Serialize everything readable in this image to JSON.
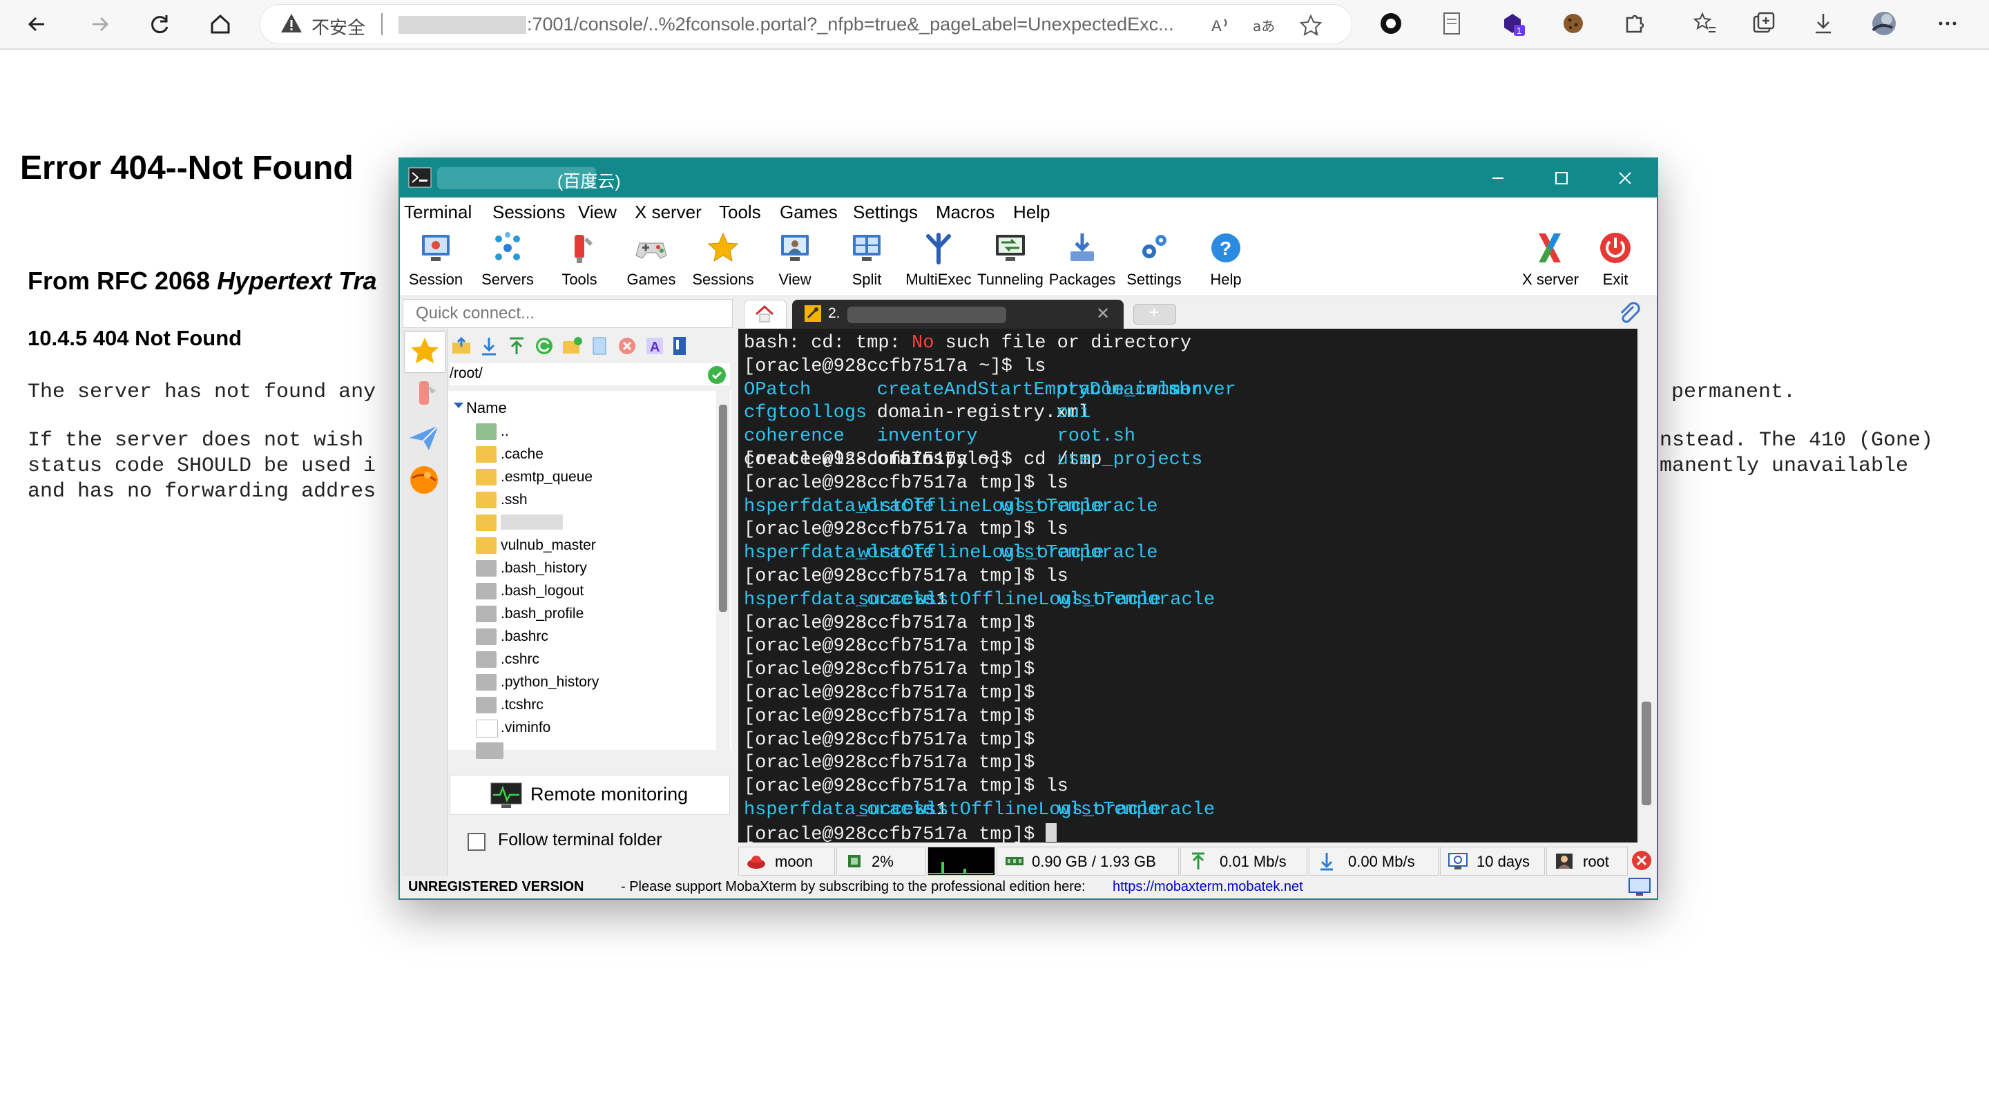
{
  "browser": {
    "security_label": "不安全",
    "url": ":7001/console/..%2fconsole.portal?_nfpb=true&_pageLabel=UnexpectedExc...",
    "ext_badge": "1"
  },
  "page": {
    "title": "Error 404--Not Found",
    "rfc_prefix": "From RFC 2068 ",
    "rfc_italic": "Hypertext Tra",
    "section": "10.4.5 404 Not Found",
    "line1_left": "The server has not found any",
    "line1_right": "permanent.",
    "line2_left": "If the server does not wish",
    "line2_right": "nstead. The 410 (Gone)",
    "line3_left": "status code SHOULD be used i",
    "line3_right": "manently unavailable",
    "line4_left": "and has no forwarding addres"
  },
  "window": {
    "title": "(百度云)",
    "menu": [
      "Terminal",
      "Sessions",
      "View",
      "X server",
      "Tools",
      "Games",
      "Settings",
      "Macros",
      "Help"
    ],
    "toolbar": [
      "Session",
      "Servers",
      "Tools",
      "Games",
      "Sessions",
      "View",
      "Split",
      "MultiExec",
      "Tunneling",
      "Packages",
      "Settings",
      "Help",
      "X server",
      "Exit"
    ]
  },
  "sidebar": {
    "quick_connect_placeholder": "Quick connect...",
    "path": "/root/",
    "tree_header": "Name",
    "items": [
      "..",
      ".cache",
      ".esmtp_queue",
      ".ssh",
      "",
      "vulnub_master",
      ".bash_history",
      ".bash_logout",
      ".bash_profile",
      ".bashrc",
      ".cshrc",
      ".python_history",
      ".tcshrc",
      ".viminfo"
    ],
    "remote_monitoring": "Remote monitoring",
    "follow_terminal": "Follow terminal folder"
  },
  "tabs": {
    "session_label": "2."
  },
  "terminal": {
    "lines": [
      "bash: cd: tmp: |No| such file or directory",
      "[oracle@928ccfb7517a ~]$ ls",
      "",
      "",
      "",
      "[oracle@928ccfb7517a ~]$ cd /tmp",
      "[oracle@928ccfb7517a tmp]$ ls",
      "",
      "[oracle@928ccfb7517a tmp]$ ls",
      "",
      "[oracle@928ccfb7517a tmp]$ ls",
      "",
      "[oracle@928ccfb7517a tmp]$",
      "[oracle@928ccfb7517a tmp]$",
      "[oracle@928ccfb7517a tmp]$",
      "[oracle@928ccfb7517a tmp]$",
      "[oracle@928ccfb7517a tmp]$",
      "[oracle@928ccfb7517a tmp]$",
      "[oracle@928ccfb7517a tmp]$",
      "[oracle@928ccfb7517a tmp]$ ls",
      "",
      "[oracle@928ccfb7517a tmp]$ "
    ],
    "ls_home": [
      [
        "OPatch",
        "createAndStartEmptyDomain.sh",
        "oracle_common",
        "wlserver"
      ],
      [
        "cfgtoollogs",
        "domain-registry.xml",
        "oui",
        ""
      ],
      [
        "coherence",
        "inventory",
        "root.sh",
        ""
      ],
      [
        "create-wls-domain.py",
        "oraInst.loc",
        "user_projects",
        ""
      ]
    ],
    "ls_tmp_a": [
      "hsperfdata_oracle",
      "wlstOfflineLogs_oracle",
      "wlstTemporacle"
    ],
    "ls_tmp_b": [
      "hsperfdata_oracle",
      "success1",
      "wlstOfflineLogs_oracle",
      "wlstTemporacle"
    ]
  },
  "status": {
    "host": "moon",
    "cpu": "2%",
    "memory": "0.90 GB / 1.93 GB",
    "upload": "0.01 Mb/s",
    "download": "0.00 Mb/s",
    "uptime": "10 days",
    "user": "root"
  },
  "footer": {
    "unregistered": "UNREGISTERED VERSION",
    "support_text": "-  Please support MobaXterm by subscribing to the professional edition here:",
    "link": "https://mobaxterm.mobatek.net"
  },
  "colors": {
    "titlebar": "#12898b",
    "terminal_bg": "#1c1c1c",
    "terminal_cyan": "#2cc4f2",
    "terminal_red": "#ff4040"
  }
}
